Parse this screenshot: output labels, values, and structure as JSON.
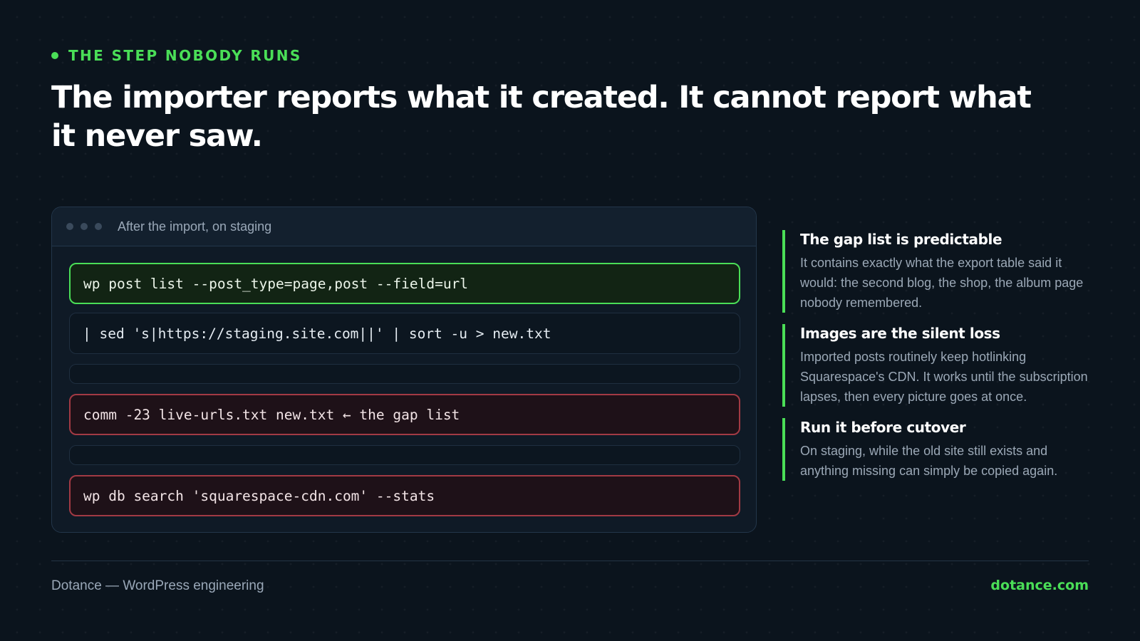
{
  "eyebrow": "THE STEP NOBODY RUNS",
  "headline": "The importer reports what it created. It cannot report what it never saw.",
  "terminal": {
    "title": "After the import, on staging",
    "lines": [
      "wp post list --post_type=page,post --field=url",
      "| sed 's|https://staging.site.com||' | sort -u > new.txt",
      "",
      "comm -23 live-urls.txt new.txt ← the gap list",
      "",
      "wp db search 'squarespace-cdn.com' --stats"
    ]
  },
  "notes": [
    {
      "title": "The gap list is predictable",
      "body": "It contains exactly what the export table said it would: the second blog, the shop, the album page nobody remembered."
    },
    {
      "title": "Images are the silent loss",
      "body": "Imported posts routinely keep hotlinking Squarespace's CDN. It works until the subscription lapses, then every picture goes at once."
    },
    {
      "title": "Run it before cutover",
      "body": "On staging, while the old site still exists and anything missing can simply be copied again."
    }
  ],
  "footer": {
    "left": "Dotance — WordPress engineering",
    "right": "dotance.com"
  },
  "colors": {
    "accent": "#4ade57",
    "danger": "#a23a44",
    "background": "#0b141d"
  }
}
